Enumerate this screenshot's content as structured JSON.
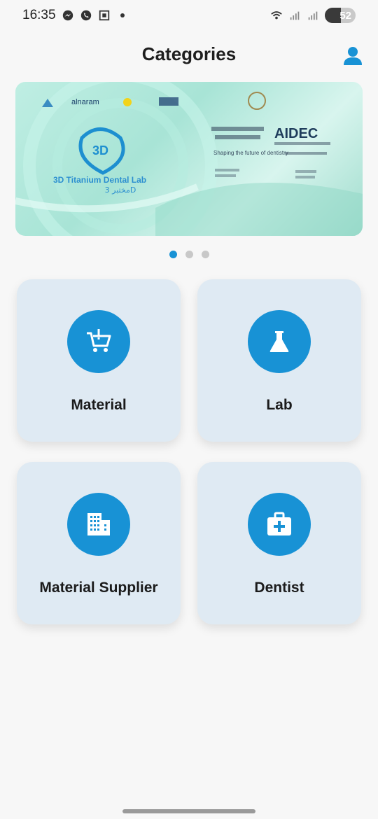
{
  "status_bar": {
    "time": "16:35",
    "battery": "52",
    "battery_level": 0.52
  },
  "header": {
    "title": "Categories"
  },
  "banner": {
    "aidec": "AIDEC",
    "product": "3D Titanium Dental Lab",
    "arabic_line": "مختبر 3D",
    "tagline": "Shaping the future of dentistry",
    "logo_3d": "3D",
    "sponsors": [
      "alnaram"
    ],
    "active_slide": 1,
    "slide_count": 3
  },
  "categories": [
    {
      "label": "Material",
      "icon": "cart-icon"
    },
    {
      "label": "Lab",
      "icon": "flask-icon"
    },
    {
      "label": "Material Supplier",
      "icon": "building-icon"
    },
    {
      "label": "Dentist",
      "icon": "medical-kit-icon"
    }
  ],
  "colors": {
    "accent": "#1892d5",
    "card_bg": "#dfeaf3",
    "page_bg": "#f7f7f7"
  }
}
